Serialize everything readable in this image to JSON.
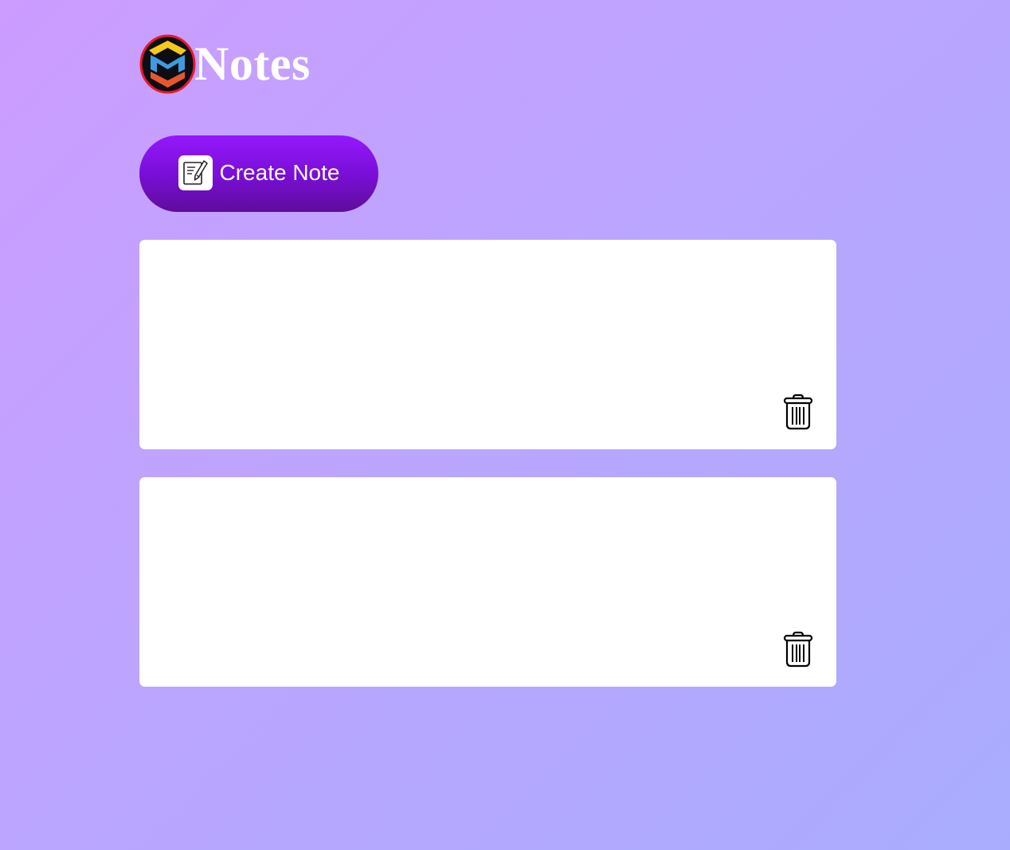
{
  "app": {
    "title": "Notes",
    "logo_icon": "m-shield-logo-icon"
  },
  "toolbar": {
    "create_label": "Create Note",
    "create_icon": "edit-note-icon"
  },
  "notes": [
    {
      "text": "",
      "delete_icon": "trash-icon"
    },
    {
      "text": "",
      "delete_icon": "trash-icon"
    }
  ],
  "colors": {
    "background_start": "#cc9cff",
    "background_end": "#a9acfd",
    "button_top": "#9418fb",
    "button_bottom": "#5f0c9b",
    "card": "#ffffff",
    "title": "#ffffff"
  }
}
